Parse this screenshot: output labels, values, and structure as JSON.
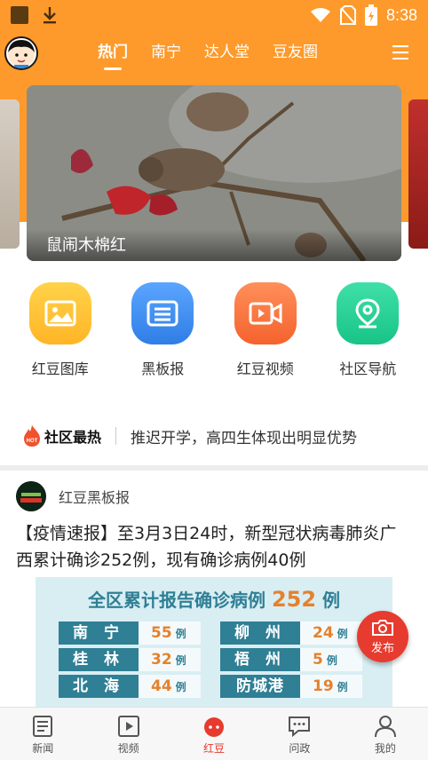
{
  "status_bar": {
    "time": "8:38"
  },
  "nav": {
    "tabs": [
      {
        "label": "热门",
        "active": true
      },
      {
        "label": "南宁",
        "active": false
      },
      {
        "label": "达人堂",
        "active": false
      },
      {
        "label": "豆友圈",
        "active": false
      }
    ]
  },
  "banner": {
    "caption": "鼠闹木棉红"
  },
  "quick_links": [
    {
      "label": "红豆图库",
      "icon": "image-icon",
      "color": "#ffc236"
    },
    {
      "label": "黑板报",
      "icon": "board-icon",
      "color": "#3f8ff0"
    },
    {
      "label": "红豆视频",
      "icon": "video-icon",
      "color": "#ff7a3c"
    },
    {
      "label": "社区导航",
      "icon": "location-icon",
      "color": "#2dd39a"
    }
  ],
  "hot": {
    "badge": "HOT",
    "title": "社区最热",
    "text": "推迟开学，高四生体现出明显优势"
  },
  "post": {
    "author": "红豆黑板报",
    "title": "【疫情速报】至3月3日24时，新型冠状病毒肺炎广西累计确诊252例，现有确诊病例40例",
    "infographic": {
      "title_prefix": "全区累计报告确诊病例",
      "total": "252",
      "unit": "例",
      "rows": [
        {
          "city_left": "南 宁",
          "val_left": "55",
          "city_right": "柳 州",
          "val_right": "24"
        },
        {
          "city_left": "桂 林",
          "val_left": "32",
          "city_right": "梧 州",
          "val_right": "5"
        },
        {
          "city_left": "北 海",
          "val_left": "44",
          "city_right": "防城港",
          "val_right": "19"
        }
      ],
      "row_unit": "例"
    }
  },
  "fab": {
    "label": "发布"
  },
  "bottom_nav": [
    {
      "label": "新闻",
      "active": false
    },
    {
      "label": "视频",
      "active": false
    },
    {
      "label": "红豆",
      "active": true
    },
    {
      "label": "问政",
      "active": false
    },
    {
      "label": "我的",
      "active": false
    }
  ],
  "colors": {
    "brand_orange": "#fd9a2b",
    "accent_red": "#e63b2e"
  }
}
